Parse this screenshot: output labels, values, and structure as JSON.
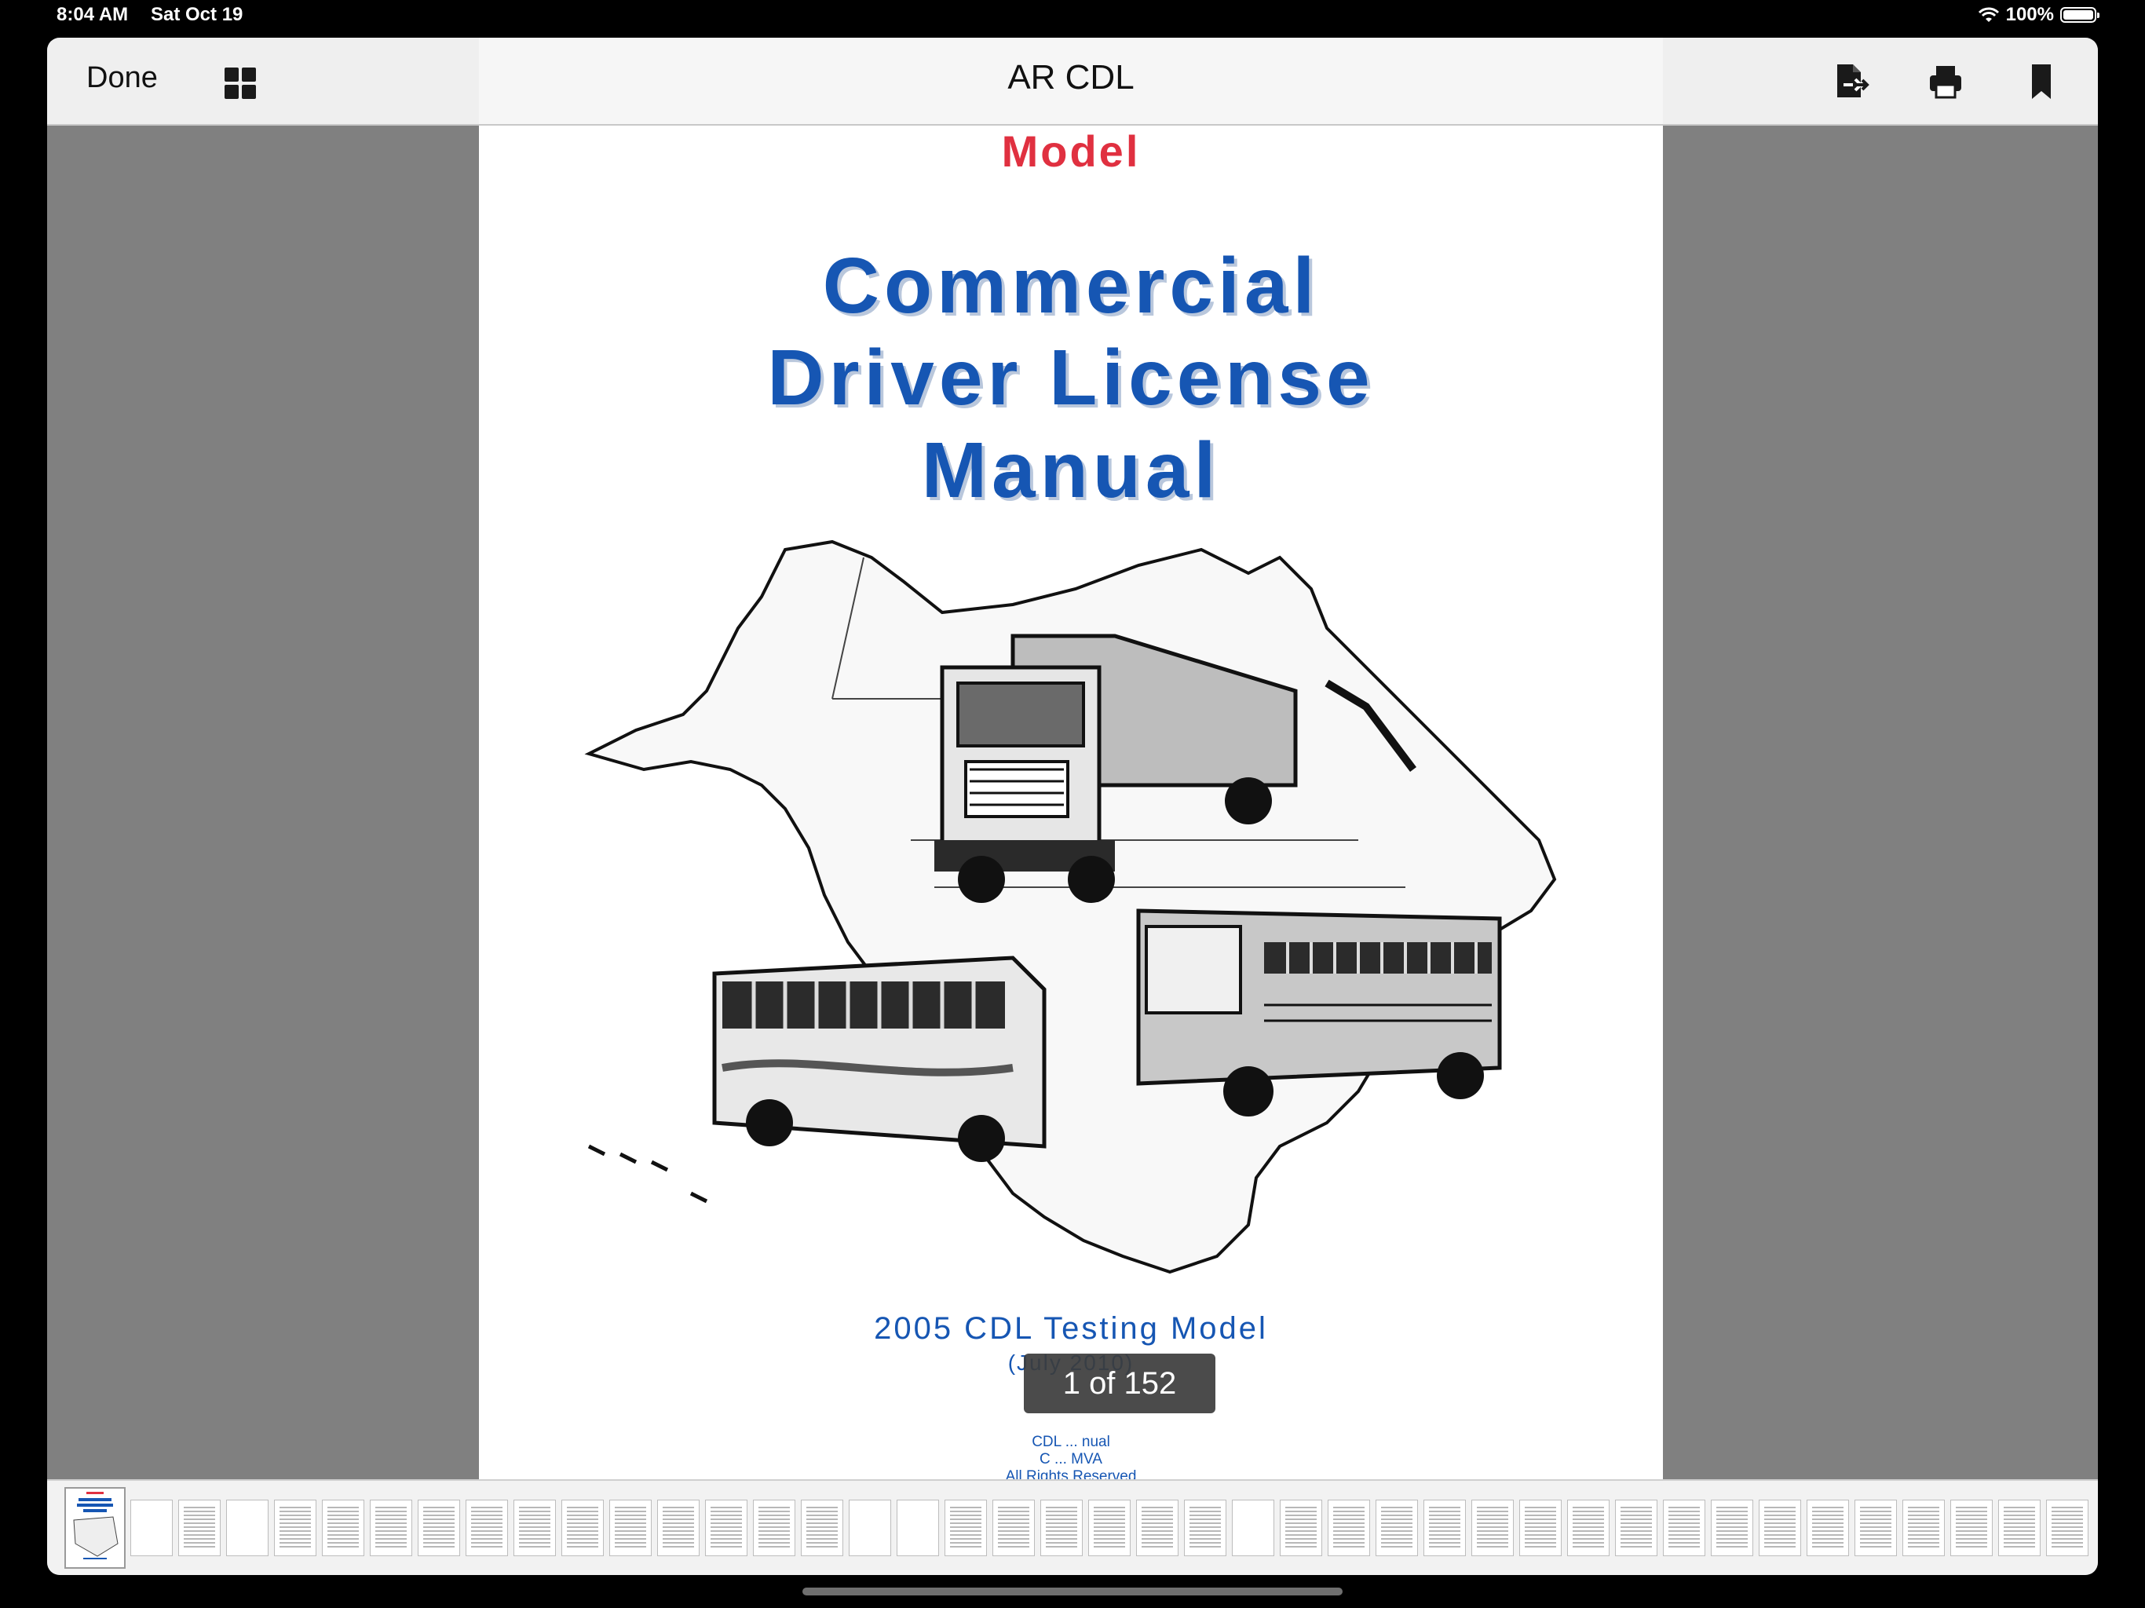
{
  "status_bar": {
    "time": "8:04 AM",
    "date": "Sat Oct 19",
    "battery": "100%"
  },
  "toolbar": {
    "done_label": "Done",
    "title": "AR CDL",
    "icons": [
      "grid-view-icon",
      "share-export-icon",
      "print-icon",
      "bookmark-icon"
    ]
  },
  "cover": {
    "model": "Model",
    "title_line1": "Commercial",
    "title_line2": "Driver License",
    "title_line3": "Manual",
    "subtitle": "2005 CDL Testing Model",
    "date": "(July 2010)",
    "foot_line1": "CDL ... nual",
    "foot_line2": "C ... MVA",
    "foot_line3": "All Rights Reserved"
  },
  "page_indicator": "1 of 152",
  "colors": {
    "title_blue": "#1656b3",
    "model_red": "#e03040",
    "background_gray": "#808080"
  }
}
